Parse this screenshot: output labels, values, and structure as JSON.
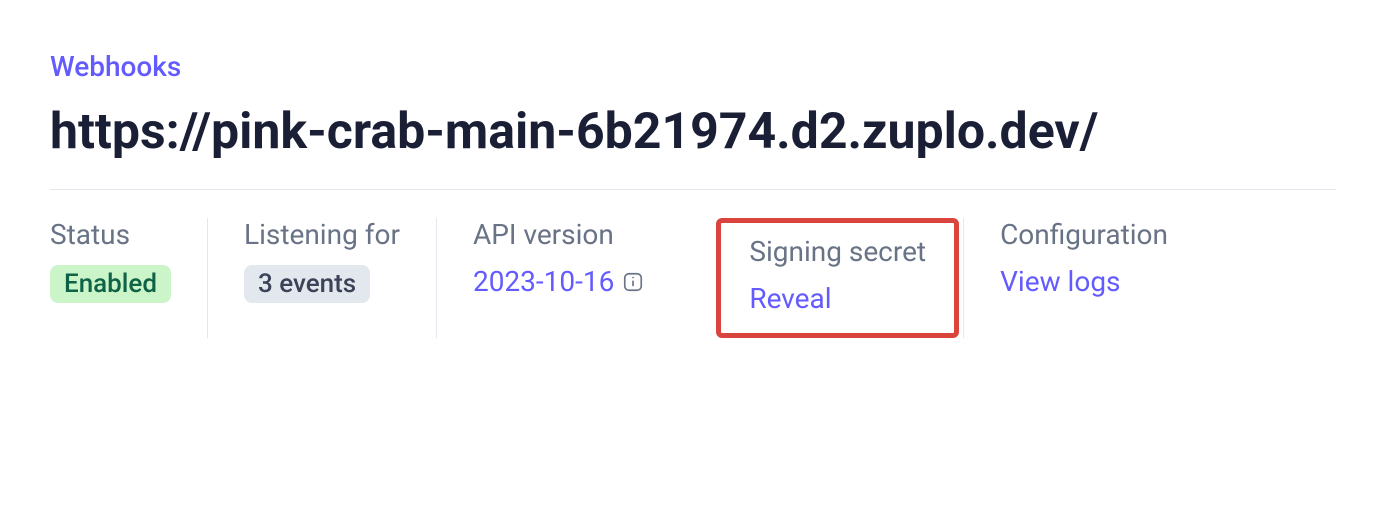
{
  "breadcrumb": {
    "label": "Webhooks"
  },
  "header": {
    "title": "https://pink-crab-main-6b21974.d2.zuplo.dev/"
  },
  "details": {
    "status": {
      "label": "Status",
      "value": "Enabled"
    },
    "listening": {
      "label": "Listening for",
      "value": "3 events"
    },
    "api_version": {
      "label": "API version",
      "value": "2023-10-16"
    },
    "signing_secret": {
      "label": "Signing secret",
      "action": "Reveal"
    },
    "configuration": {
      "label": "Configuration",
      "action": "View logs"
    }
  }
}
